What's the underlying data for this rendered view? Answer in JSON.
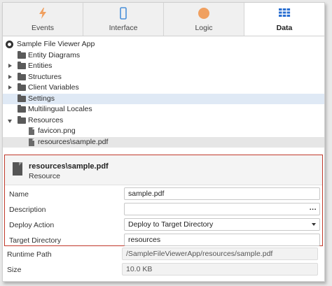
{
  "tabs": [
    {
      "label": "Events",
      "icon": "lightning-icon",
      "color": "#f0a060"
    },
    {
      "label": "Interface",
      "icon": "phone-icon",
      "color": "#4a90d9"
    },
    {
      "label": "Logic",
      "icon": "circle-icon",
      "color": "#f0a060"
    },
    {
      "label": "Data",
      "icon": "table-icon",
      "color": "#2a6fd1"
    }
  ],
  "tree": {
    "root": "Sample File Viewer App",
    "items": [
      {
        "label": "Entity Diagrams"
      },
      {
        "label": "Entities"
      },
      {
        "label": "Structures"
      },
      {
        "label": "Client Variables"
      },
      {
        "label": "Settings"
      },
      {
        "label": "Multilingual Locales"
      },
      {
        "label": "Resources"
      },
      {
        "label": "favicon.png"
      },
      {
        "label": "resources\\sample.pdf"
      }
    ]
  },
  "details": {
    "title": "resources\\sample.pdf",
    "subtitle": "Resource",
    "props": {
      "name_label": "Name",
      "name_value": "sample.pdf",
      "description_label": "Description",
      "description_value": "",
      "description_button": "...",
      "deploy_label": "Deploy Action",
      "deploy_value": "Deploy to Target Directory",
      "target_label": "Target Directory",
      "target_value": "resources",
      "runtime_label": "Runtime Path",
      "runtime_value": "/SampleFileViewerApp/resources/sample.pdf",
      "size_label": "Size",
      "size_value": "10.0 KB"
    }
  },
  "colors": {
    "highlight_border": "#c0392b",
    "selected_row": "#dfe9f5"
  }
}
